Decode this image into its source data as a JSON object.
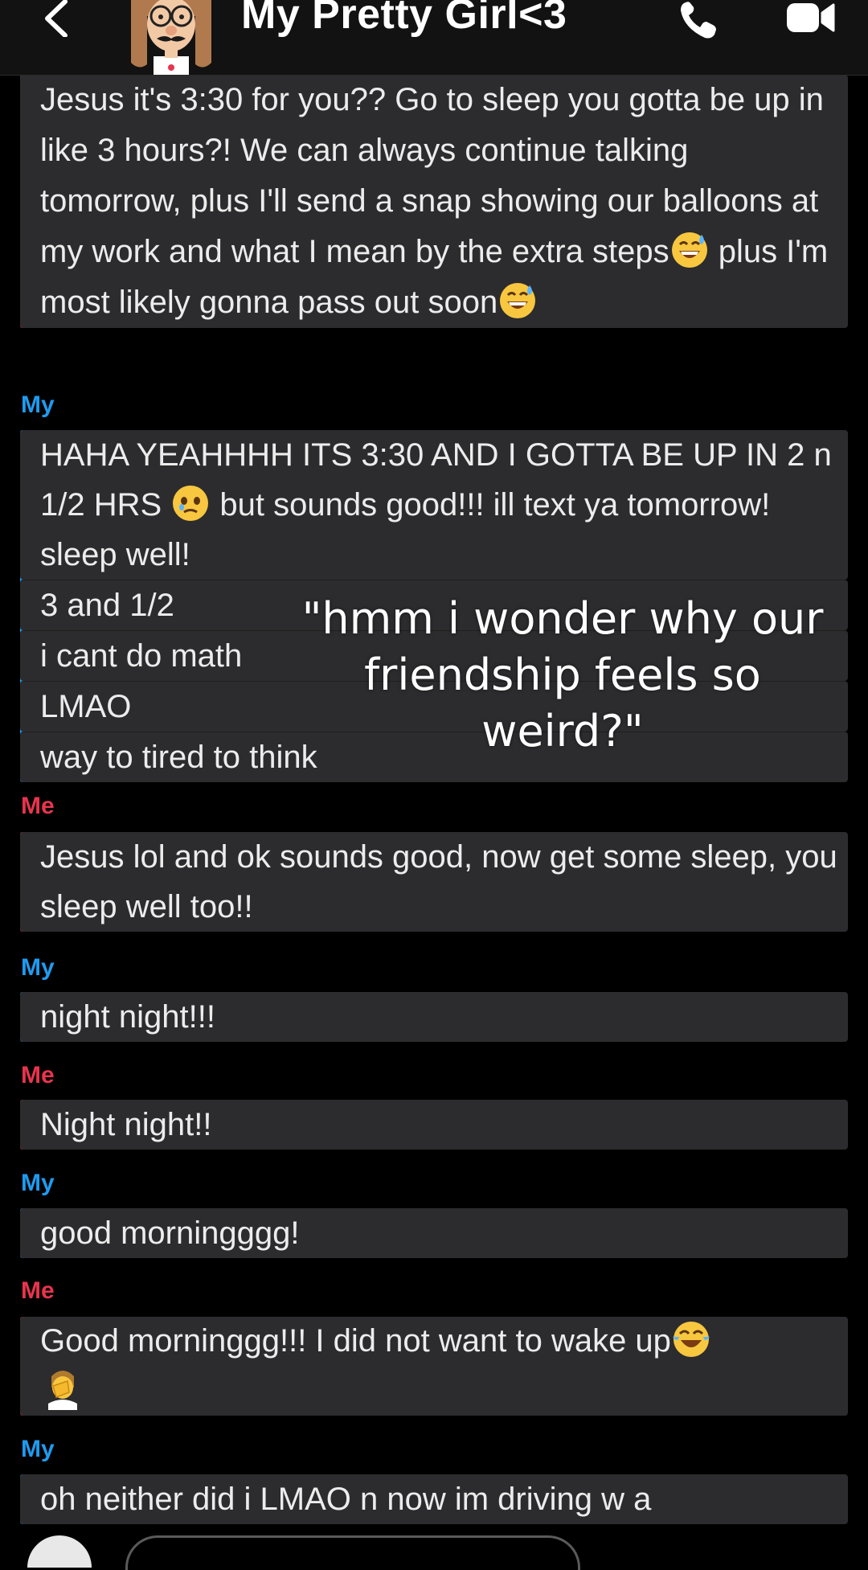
{
  "header": {
    "title": "My Pretty Girl<3",
    "back_icon": "chevron-left-icon",
    "call_icon": "phone-icon",
    "video_icon": "video-camera-icon"
  },
  "colors": {
    "me": "#e8344e",
    "my": "#1f9bf0",
    "bubble": "#2c2c2e",
    "background": "#000000"
  },
  "overlay_caption": "\"hmm i wonder why our friendship feels so weird?\"",
  "messages": [
    {
      "sender": "",
      "side": "me",
      "lines": [
        "Jesus it's 3:30 for you?? Go to sleep you gotta be up in like 3 hours?! We can always continue talking tomorrow, plus I'll send a snap showing our balloons at my work and what I mean by the extra steps",
        " plus I'm most likely gonna pass out soon"
      ]
    },
    {
      "sender": "My",
      "side": "my",
      "lines": [
        "HAHA YEAHHHH ITS 3:30 AND I GOTTA BE UP IN 2 n 1/2 HRS ",
        " but sounds good!!! ill text ya tomorrow! sleep well!",
        "3 and 1/2",
        "i cant do math",
        "LMAO",
        "way to tired to think"
      ]
    },
    {
      "sender": "Me",
      "side": "me",
      "lines": [
        "Jesus lol and ok sounds good, now get some sleep, you sleep well too!!"
      ]
    },
    {
      "sender": "My",
      "side": "my",
      "lines": [
        "night night!!!"
      ]
    },
    {
      "sender": "Me",
      "side": "me",
      "lines": [
        "Night night!!"
      ]
    },
    {
      "sender": "My",
      "side": "my",
      "lines": [
        "good morningggg!"
      ]
    },
    {
      "sender": "Me",
      "side": "me",
      "lines": [
        "Good morninggg!!! I did not want to wake up"
      ]
    },
    {
      "sender": "My",
      "side": "my",
      "lines": [
        "oh neither did i LMAO n now im driving w a"
      ]
    }
  ],
  "emoji_names": {
    "sweat_smile": "grinning-face-with-sweat-emoji",
    "holding_tears": "face-holding-back-tears-emoji",
    "tears_of_joy": "face-with-tears-of-joy-emoji",
    "facepalm": "person-facepalming-emoji"
  }
}
